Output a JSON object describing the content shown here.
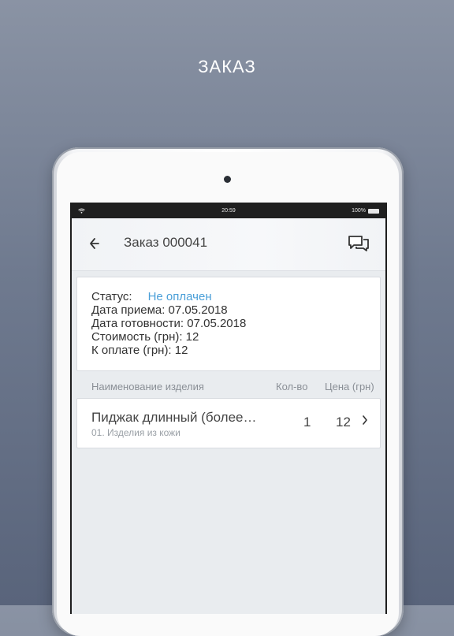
{
  "headline": "ЗАКАЗ",
  "statusbar": {
    "time": "20:59",
    "battery": "100%"
  },
  "appbar": {
    "title": "Заказ 000041"
  },
  "order": {
    "status_label": "Статус:",
    "status_value": "Не оплачен",
    "accept_date": "Дата приема: 07.05.2018",
    "ready_date": "Дата готовности: 07.05.2018",
    "cost": "Стоимость (грн): 12",
    "to_pay": "К оплате (грн): 12"
  },
  "table": {
    "headers": {
      "name": "Наименование изделия",
      "qty": "Кол-во",
      "price": "Цена (грн)"
    },
    "items": [
      {
        "name": "Пиджак длинный (более…",
        "category": "01. Изделия из кожи",
        "qty": "1",
        "price": "12"
      }
    ]
  },
  "colors": {
    "status_accent": "#4a9fd8"
  },
  "icons": {
    "back": "back-arrow-icon",
    "chat": "chat-bubbles-icon",
    "chevron": "chevron-right-icon"
  }
}
